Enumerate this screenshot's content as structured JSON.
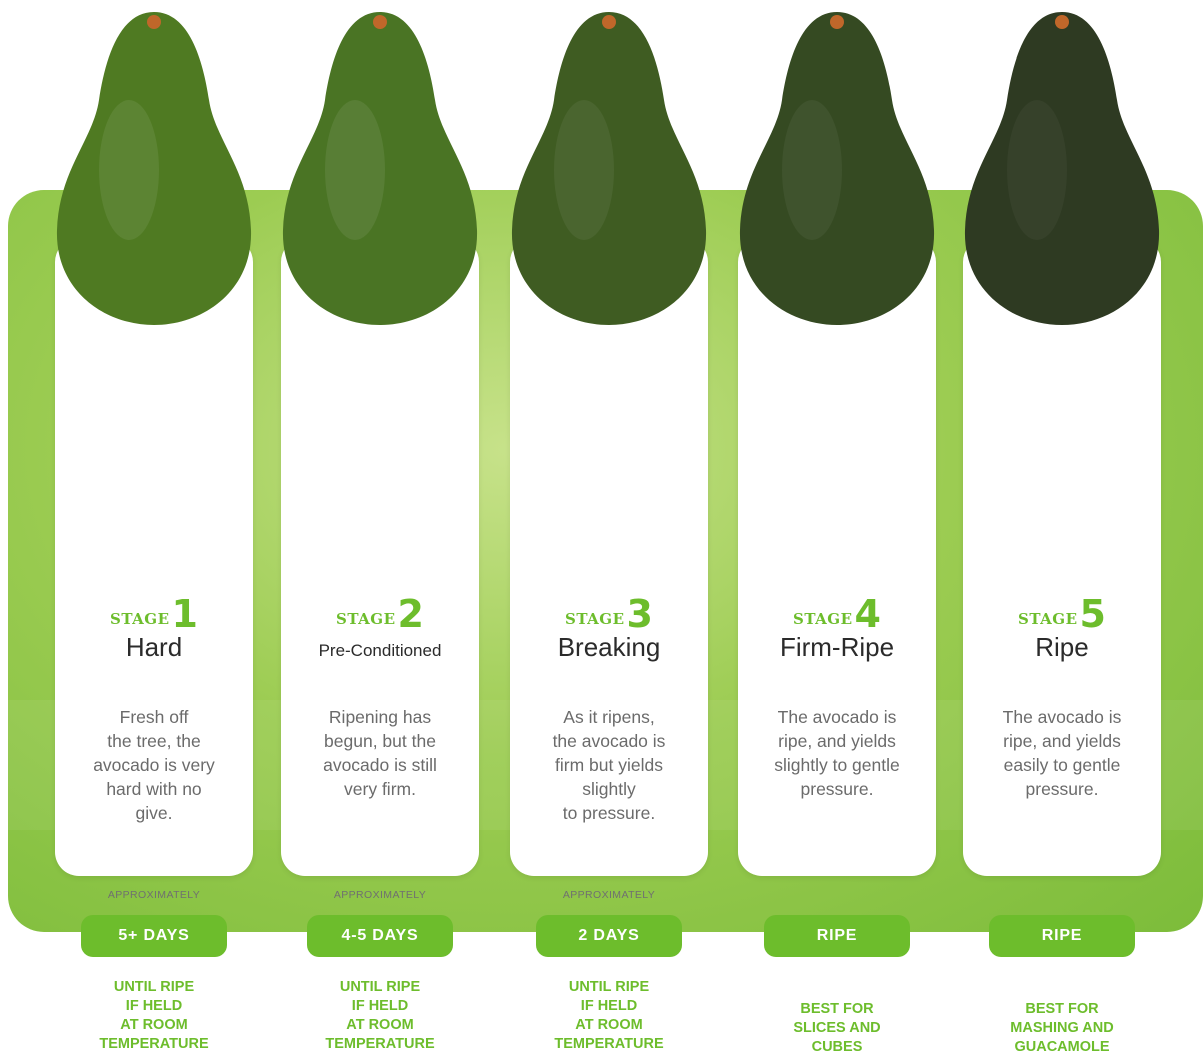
{
  "colors": {
    "accent": "#6dbd2c",
    "background_green": "#8dc63f",
    "card": "#ffffff"
  },
  "stages": [
    {
      "stage_word": "STAGE",
      "number": "1",
      "title": "Hard",
      "description": "Fresh off\nthe tree, the\navocado is very\nhard with no\ngive.",
      "approx": "APPROXIMATELY",
      "pill": "5+ DAYS",
      "note": "UNTIL RIPE\nIF HELD\nAT ROOM\nTEMPERATURE",
      "skin": "#4f7a22"
    },
    {
      "stage_word": "STAGE",
      "number": "2",
      "title": "Pre-Conditioned",
      "description": "Ripening has\nbegun, but the\navocado is still\nvery firm.",
      "approx": "APPROXIMATELY",
      "pill": "4-5 DAYS",
      "note": "UNTIL RIPE\nIF HELD\nAT ROOM\nTEMPERATURE",
      "skin": "#4a7424"
    },
    {
      "stage_word": "STAGE",
      "number": "3",
      "title": "Breaking",
      "description": "As it ripens,\nthe avocado is\nfirm but yields\nslightly\nto pressure.",
      "approx": "APPROXIMATELY",
      "pill": "2 DAYS",
      "note": "UNTIL RIPE\nIF HELD\nAT ROOM\nTEMPERATURE",
      "skin": "#3f5c22"
    },
    {
      "stage_word": "STAGE",
      "number": "4",
      "title": "Firm-Ripe",
      "description": "The avocado is\nripe, and yields\nslightly to gentle\npressure.",
      "approx": "",
      "pill": "RIPE",
      "note": "BEST FOR\nSLICES AND\nCUBES",
      "skin": "#354a22"
    },
    {
      "stage_word": "STAGE",
      "number": "5",
      "title": "Ripe",
      "description": "The avocado is\nripe, and yields\neasily to gentle\npressure.",
      "approx": "",
      "pill": "RIPE",
      "note": "BEST FOR\nMASHING AND\nGUACAMOLE",
      "skin": "#2e3a22"
    }
  ]
}
